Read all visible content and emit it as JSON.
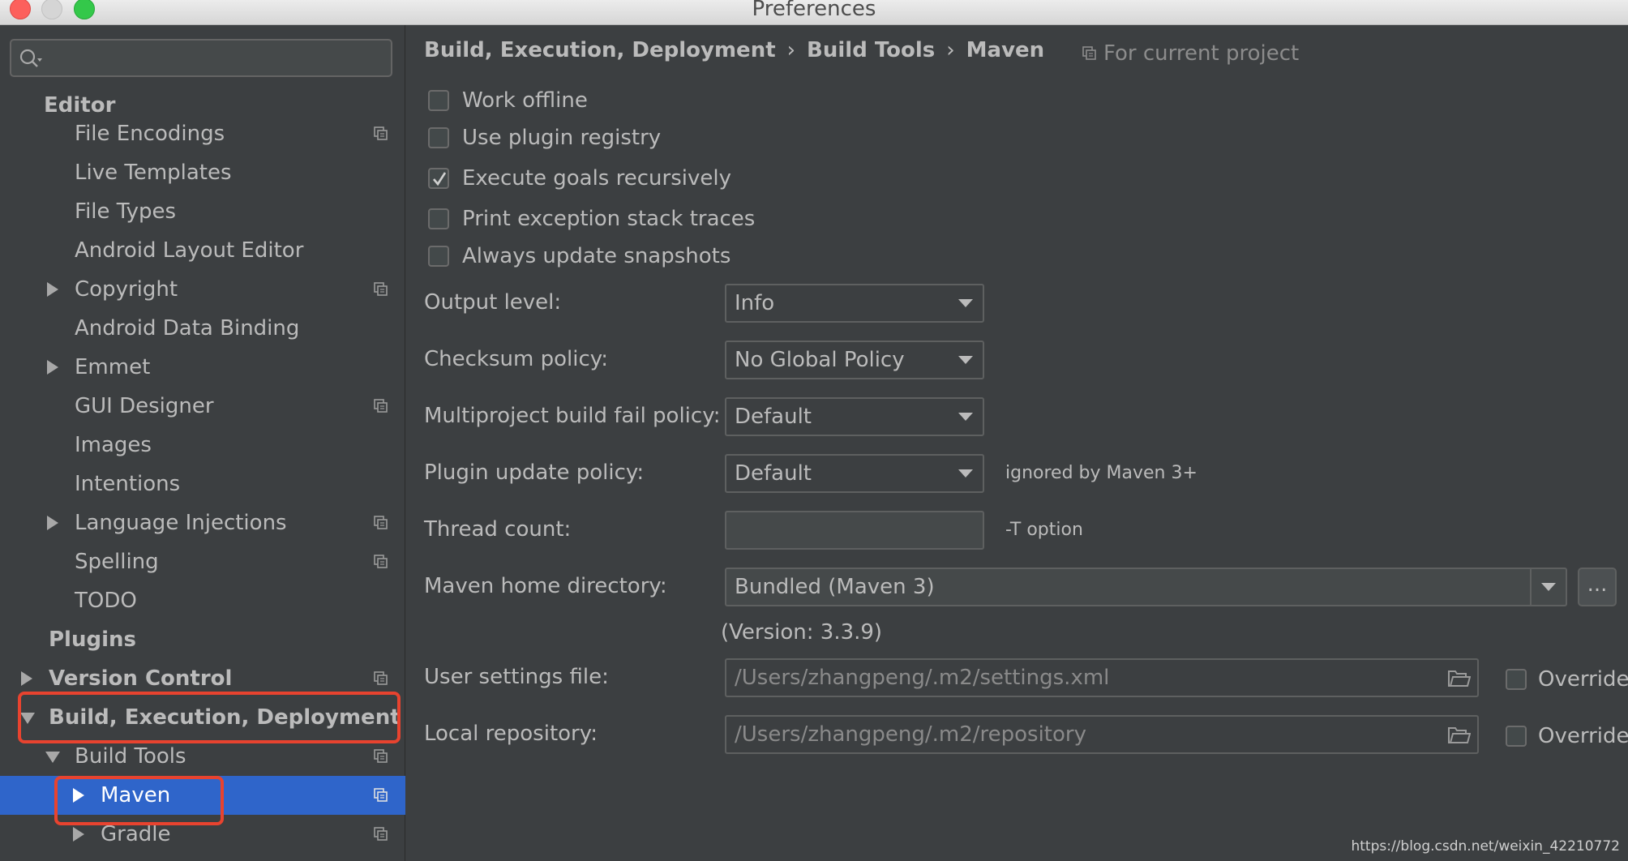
{
  "window": {
    "title": "Preferences"
  },
  "search": {
    "value": ""
  },
  "sidebar": {
    "items": [
      {
        "label": "Editor",
        "bold": true,
        "arrow": "none",
        "copy": false
      },
      {
        "label": "File Encodings",
        "bold": false,
        "arrow": "none",
        "copy": true
      },
      {
        "label": "Live Templates",
        "bold": false,
        "arrow": "none",
        "copy": false
      },
      {
        "label": "File Types",
        "bold": false,
        "arrow": "none",
        "copy": false
      },
      {
        "label": "Android Layout Editor",
        "bold": false,
        "arrow": "none",
        "copy": false
      },
      {
        "label": "Copyright",
        "bold": false,
        "arrow": "right",
        "copy": true
      },
      {
        "label": "Android Data Binding",
        "bold": false,
        "arrow": "none",
        "copy": false
      },
      {
        "label": "Emmet",
        "bold": false,
        "arrow": "right",
        "copy": false
      },
      {
        "label": "GUI Designer",
        "bold": false,
        "arrow": "none",
        "copy": true
      },
      {
        "label": "Images",
        "bold": false,
        "arrow": "none",
        "copy": false
      },
      {
        "label": "Intentions",
        "bold": false,
        "arrow": "none",
        "copy": false
      },
      {
        "label": "Language Injections",
        "bold": false,
        "arrow": "right",
        "copy": true
      },
      {
        "label": "Spelling",
        "bold": false,
        "arrow": "none",
        "copy": true
      },
      {
        "label": "TODO",
        "bold": false,
        "arrow": "none",
        "copy": false
      },
      {
        "label": "Plugins",
        "bold": true,
        "arrow": "none",
        "copy": false
      },
      {
        "label": "Version Control",
        "bold": true,
        "arrow": "right",
        "copy": true
      },
      {
        "label": "Build, Execution, Deployment",
        "bold": true,
        "arrow": "down",
        "copy": false
      },
      {
        "label": "Build Tools",
        "bold": false,
        "arrow": "down",
        "copy": true
      },
      {
        "label": "Maven",
        "bold": false,
        "arrow": "right",
        "copy": true,
        "selected": true
      },
      {
        "label": "Gradle",
        "bold": false,
        "arrow": "right",
        "copy": true
      }
    ]
  },
  "breadcrumb": {
    "parts": [
      "Build, Execution, Deployment",
      "Build Tools",
      "Maven"
    ],
    "separator": "›"
  },
  "scope_label": "For current project",
  "checkboxes": [
    {
      "label": "Work offline",
      "checked": false
    },
    {
      "label": "Use plugin registry",
      "checked": false
    },
    {
      "label": "Execute goals recursively",
      "checked": true
    },
    {
      "label": "Print exception stack traces",
      "checked": false
    },
    {
      "label": "Always update snapshots",
      "checked": false
    }
  ],
  "form": {
    "output_level": {
      "label": "Output level:",
      "value": "Info"
    },
    "checksum_policy": {
      "label": "Checksum policy:",
      "value": "No Global Policy"
    },
    "multiproject_fail": {
      "label": "Multiproject build fail policy:",
      "value": "Default"
    },
    "plugin_update": {
      "label": "Plugin update policy:",
      "value": "Default",
      "hint": "ignored by Maven 3+"
    },
    "thread_count": {
      "label": "Thread count:",
      "value": "",
      "hint": "-T option"
    },
    "maven_home": {
      "label": "Maven home directory:",
      "value": "Bundled (Maven 3)",
      "browse_label": "...",
      "version": "(Version: 3.3.9)"
    },
    "user_settings": {
      "label": "User settings file:",
      "value": "/Users/zhangpeng/.m2/settings.xml",
      "override_label": "Override",
      "override_checked": false
    },
    "local_repo": {
      "label": "Local repository:",
      "value": "/Users/zhangpeng/.m2/repository",
      "override_label": "Override",
      "override_checked": false
    }
  },
  "watermark": "https://blog.csdn.net/weixin_42210772",
  "colors": {
    "background": "#3c3f41",
    "selection": "#2f65ca",
    "annotation_red": "#e8432f",
    "text": "#bbbbbb"
  }
}
